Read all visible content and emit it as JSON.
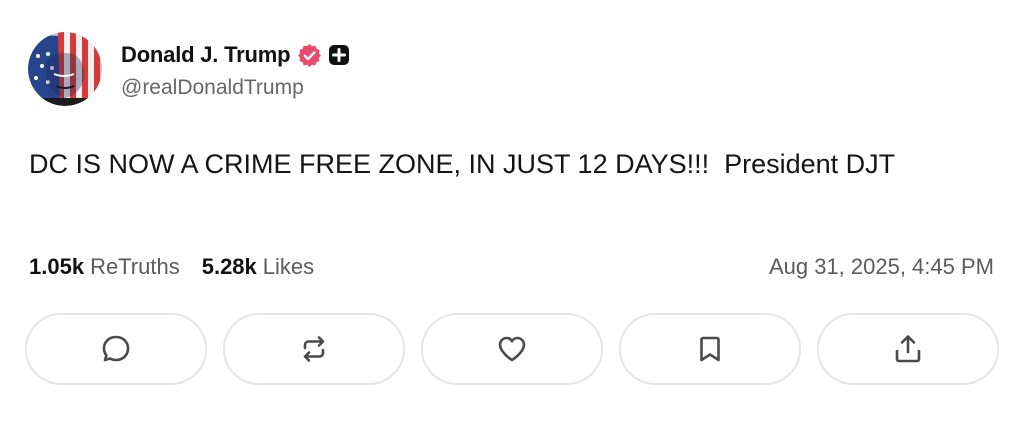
{
  "post": {
    "author": {
      "display_name": "Donald J. Trump",
      "handle": "@realDonaldTrump",
      "verified_icon": "verified-badge-icon",
      "plus_icon": "plus-badge-icon"
    },
    "text": "DC IS NOW A CRIME FREE ZONE, IN JUST 12 DAYS!!!  President DJT",
    "stats": {
      "retruths_count": "1.05k",
      "retruths_label": "ReTruths",
      "likes_count": "5.28k",
      "likes_label": "Likes"
    },
    "timestamp": "Aug 31, 2025, 4:45 PM"
  },
  "actions": [
    {
      "icon": "reply-icon"
    },
    {
      "icon": "retruth-icon"
    },
    {
      "icon": "like-heart-icon"
    },
    {
      "icon": "bookmark-icon"
    },
    {
      "icon": "share-icon"
    }
  ],
  "colors": {
    "verified": "#e94b6e",
    "text_primary": "#111111",
    "text_secondary": "#5b5b5b",
    "button_border": "#e5e5e5",
    "icon": "#4a4a4a"
  }
}
